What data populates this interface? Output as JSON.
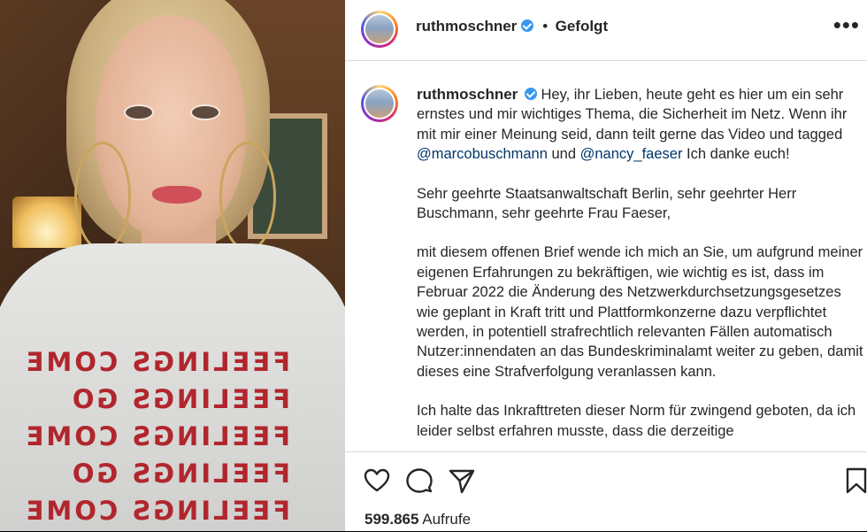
{
  "header": {
    "username": "ruthmoschner",
    "separator": "•",
    "follow_status": "Gefolgt",
    "more_label": "•••"
  },
  "video": {
    "shirt_lines": [
      "FEELINGS COME",
      "FEELINGS GO",
      "FEELINGS COME",
      "FEELINGS GO",
      "FEELINGS COME"
    ]
  },
  "caption": {
    "username": "ruthmoschner",
    "intro_text": "Hey, ihr Lieben, heute geht es hier um ein sehr ernstes und mir wichtiges Thema, die Sicherheit im Netz. Wenn ihr mit mir einer Meinung seid, dann teilt gerne das Video und tagged",
    "mention_1": "@marcobuschmann",
    "connector": "und",
    "mention_2": "@nancy_faeser",
    "intro_end": "Ich danke euch!",
    "paragraph_2": "Sehr geehrte Staatsanwaltschaft Berlin, sehr geehrter Herr Buschmann, sehr geehrte Frau Faeser,",
    "paragraph_3": "mit diesem offenen Brief wende ich mich an Sie, um aufgrund meiner eigenen Erfahrungen zu bekräftigen, wie wichtig es ist, dass im Februar 2022 die Änderung des Netzwerkdurchsetzungsgesetzes wie geplant in Kraft tritt und Plattformkonzerne dazu verpflichtet werden, in potentiell strafrechtlich relevanten Fällen automatisch Nutzer:innendaten an das Bundeskriminalamt weiter zu geben, damit dieses eine Strafverfolgung veranlassen kann.",
    "paragraph_4": "Ich halte das Inkrafttreten dieser Norm für zwingend geboten, da ich leider selbst erfahren musste, dass die derzeitige"
  },
  "actions": {
    "views_count": "599.865",
    "views_label": "Aufrufe"
  },
  "colors": {
    "verified": "#3897f0",
    "mention": "#00376b",
    "shirt_text": "#b1262d"
  },
  "icons": [
    "verified-badge-icon",
    "more-options-icon",
    "heart-icon",
    "comment-icon",
    "share-icon",
    "bookmark-icon"
  ]
}
